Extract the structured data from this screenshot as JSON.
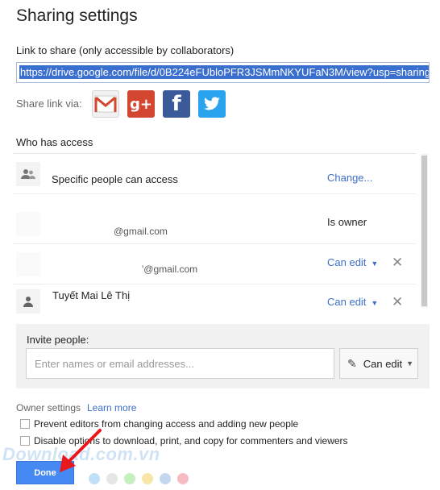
{
  "dialog": {
    "title": "Sharing settings",
    "link_label": "Link to share (only accessible by collaborators)",
    "link_url": "https://drive.google.com/file/d/0B224eFUbloPFR3JSMmNKYUFaN3M/view?usp=sharing",
    "share_via_label": "Share link via:",
    "share_services": [
      {
        "name": "Gmail",
        "icon": "gmail-icon",
        "glyph": "M",
        "color": "#d3462f"
      },
      {
        "name": "Google+",
        "icon": "google-plus-icon",
        "glyph": "g+",
        "color": "#d3462f"
      },
      {
        "name": "Facebook",
        "icon": "facebook-icon",
        "glyph": "f",
        "color": "#3b5a9a"
      },
      {
        "name": "Twitter",
        "icon": "twitter-icon",
        "glyph": "t",
        "color": "#2aa3ef"
      }
    ]
  },
  "access": {
    "heading": "Who has access",
    "visibility": {
      "text": "Specific people can access",
      "action": "Change..."
    },
    "people": [
      {
        "name": "",
        "email": "@gmail.com",
        "role": "Is owner"
      },
      {
        "name": "",
        "email": "'@gmail.com",
        "role": "Can edit"
      },
      {
        "name": "Tuyết Mai Lê Thị",
        "email": "",
        "role": "Can edit"
      }
    ]
  },
  "invite": {
    "label": "Invite people:",
    "placeholder": "Enter names or email addresses...",
    "permission": "Can edit"
  },
  "owner_settings": {
    "label": "Owner settings",
    "learn_more": "Learn more",
    "options": [
      {
        "text": "Prevent editors from changing access and adding new people",
        "checked": false
      },
      {
        "text": "Disable options to download, print, and copy for commenters and viewers",
        "checked": false
      }
    ]
  },
  "footer": {
    "done_label": "Done"
  },
  "watermark": {
    "text": "Download.com.vn",
    "dot_colors": [
      "#bfe0f7",
      "#e6e6e6",
      "#c6efc0",
      "#f7e6a8",
      "#c3d8ef",
      "#f7bcc3"
    ]
  },
  "colors": {
    "accent": "#4689f2",
    "link": "#3d6ec9",
    "selection": "#3a6fd0",
    "arrow": "#e8181c"
  }
}
